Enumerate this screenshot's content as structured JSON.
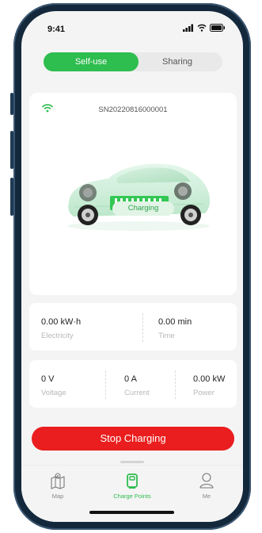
{
  "status_bar": {
    "time": "9:41"
  },
  "segment": {
    "options": [
      "Self-use",
      "Sharing"
    ],
    "selected": "Self-use"
  },
  "device": {
    "serial": "SN20220816000001",
    "status_label": "Charging"
  },
  "metrics_row1": [
    {
      "value": "0.00 kW·h",
      "label": "Electricity"
    },
    {
      "value": "0.00 min",
      "label": "Time"
    }
  ],
  "metrics_row2": [
    {
      "value": "0 V",
      "label": "Voltage"
    },
    {
      "value": "0 A",
      "label": "Current"
    },
    {
      "value": "0.00 kW",
      "label": "Power"
    }
  ],
  "action": {
    "label": "Stop Charging"
  },
  "tabbar": {
    "items": [
      {
        "label": "Map",
        "icon": "map-icon"
      },
      {
        "label": "Charge Points",
        "icon": "charger-icon"
      },
      {
        "label": "Me",
        "icon": "user-icon"
      }
    ],
    "active": "Charge Points"
  },
  "colors": {
    "accent": "#2ebd4f",
    "danger": "#ea1e1e",
    "tag_bg": "#e1f4e5"
  }
}
